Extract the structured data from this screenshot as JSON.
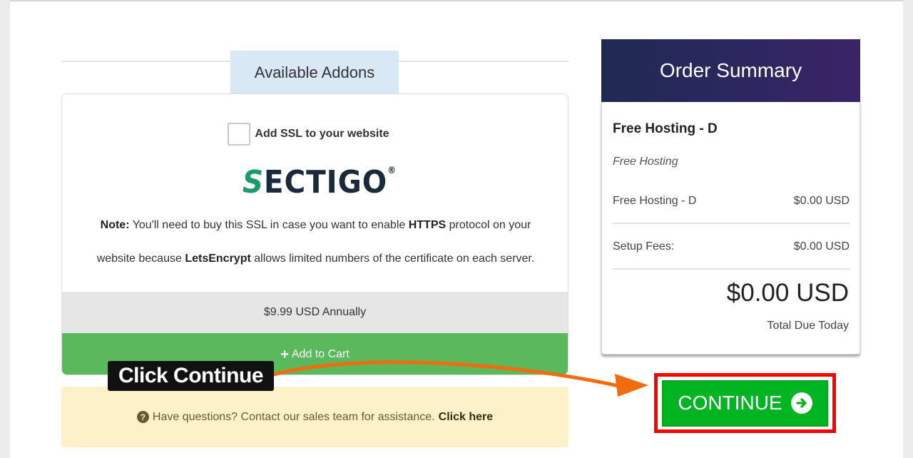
{
  "addons": {
    "tab_label": "Available Addons",
    "checkbox_label": "Add SSL to your website",
    "logo": {
      "text_first": "S",
      "text_rest": "ECTIGO",
      "reg_mark": "®",
      "color_accent": "#1c9b6a"
    },
    "note": {
      "lead": "Note:",
      "part1": " You'll need to buy this SSL in case you want to enable ",
      "emph1": "HTTPS",
      "part2": " protocol on your website because ",
      "emph2": "LetsEncrypt",
      "part3": " allows limited numbers of the certificate on each server."
    },
    "price": "$9.99 USD Annually",
    "add_to_cart_label": "Add to Cart",
    "add_to_cart_color": "#5cb85c"
  },
  "help": {
    "text": "Have questions? Contact our sales team for assistance.",
    "link": "Click here",
    "icon": "question-circle-icon"
  },
  "summary": {
    "title": "Order Summary",
    "product_name": "Free Hosting - D",
    "product_group": "Free Hosting",
    "lines": [
      {
        "label": "Free Hosting - D",
        "value": "$0.00 USD"
      },
      {
        "label": "Setup Fees:",
        "value": "$0.00 USD"
      }
    ],
    "total": "$0.00 USD",
    "total_label": "Total Due Today"
  },
  "continue": {
    "label": "CONTINUE",
    "icon": "arrow-circle-right-icon",
    "color": "#00b521",
    "highlight_color": "#ff0000"
  },
  "annotation": {
    "callout": "Click Continue",
    "arrow_color": "#f26b0f"
  }
}
